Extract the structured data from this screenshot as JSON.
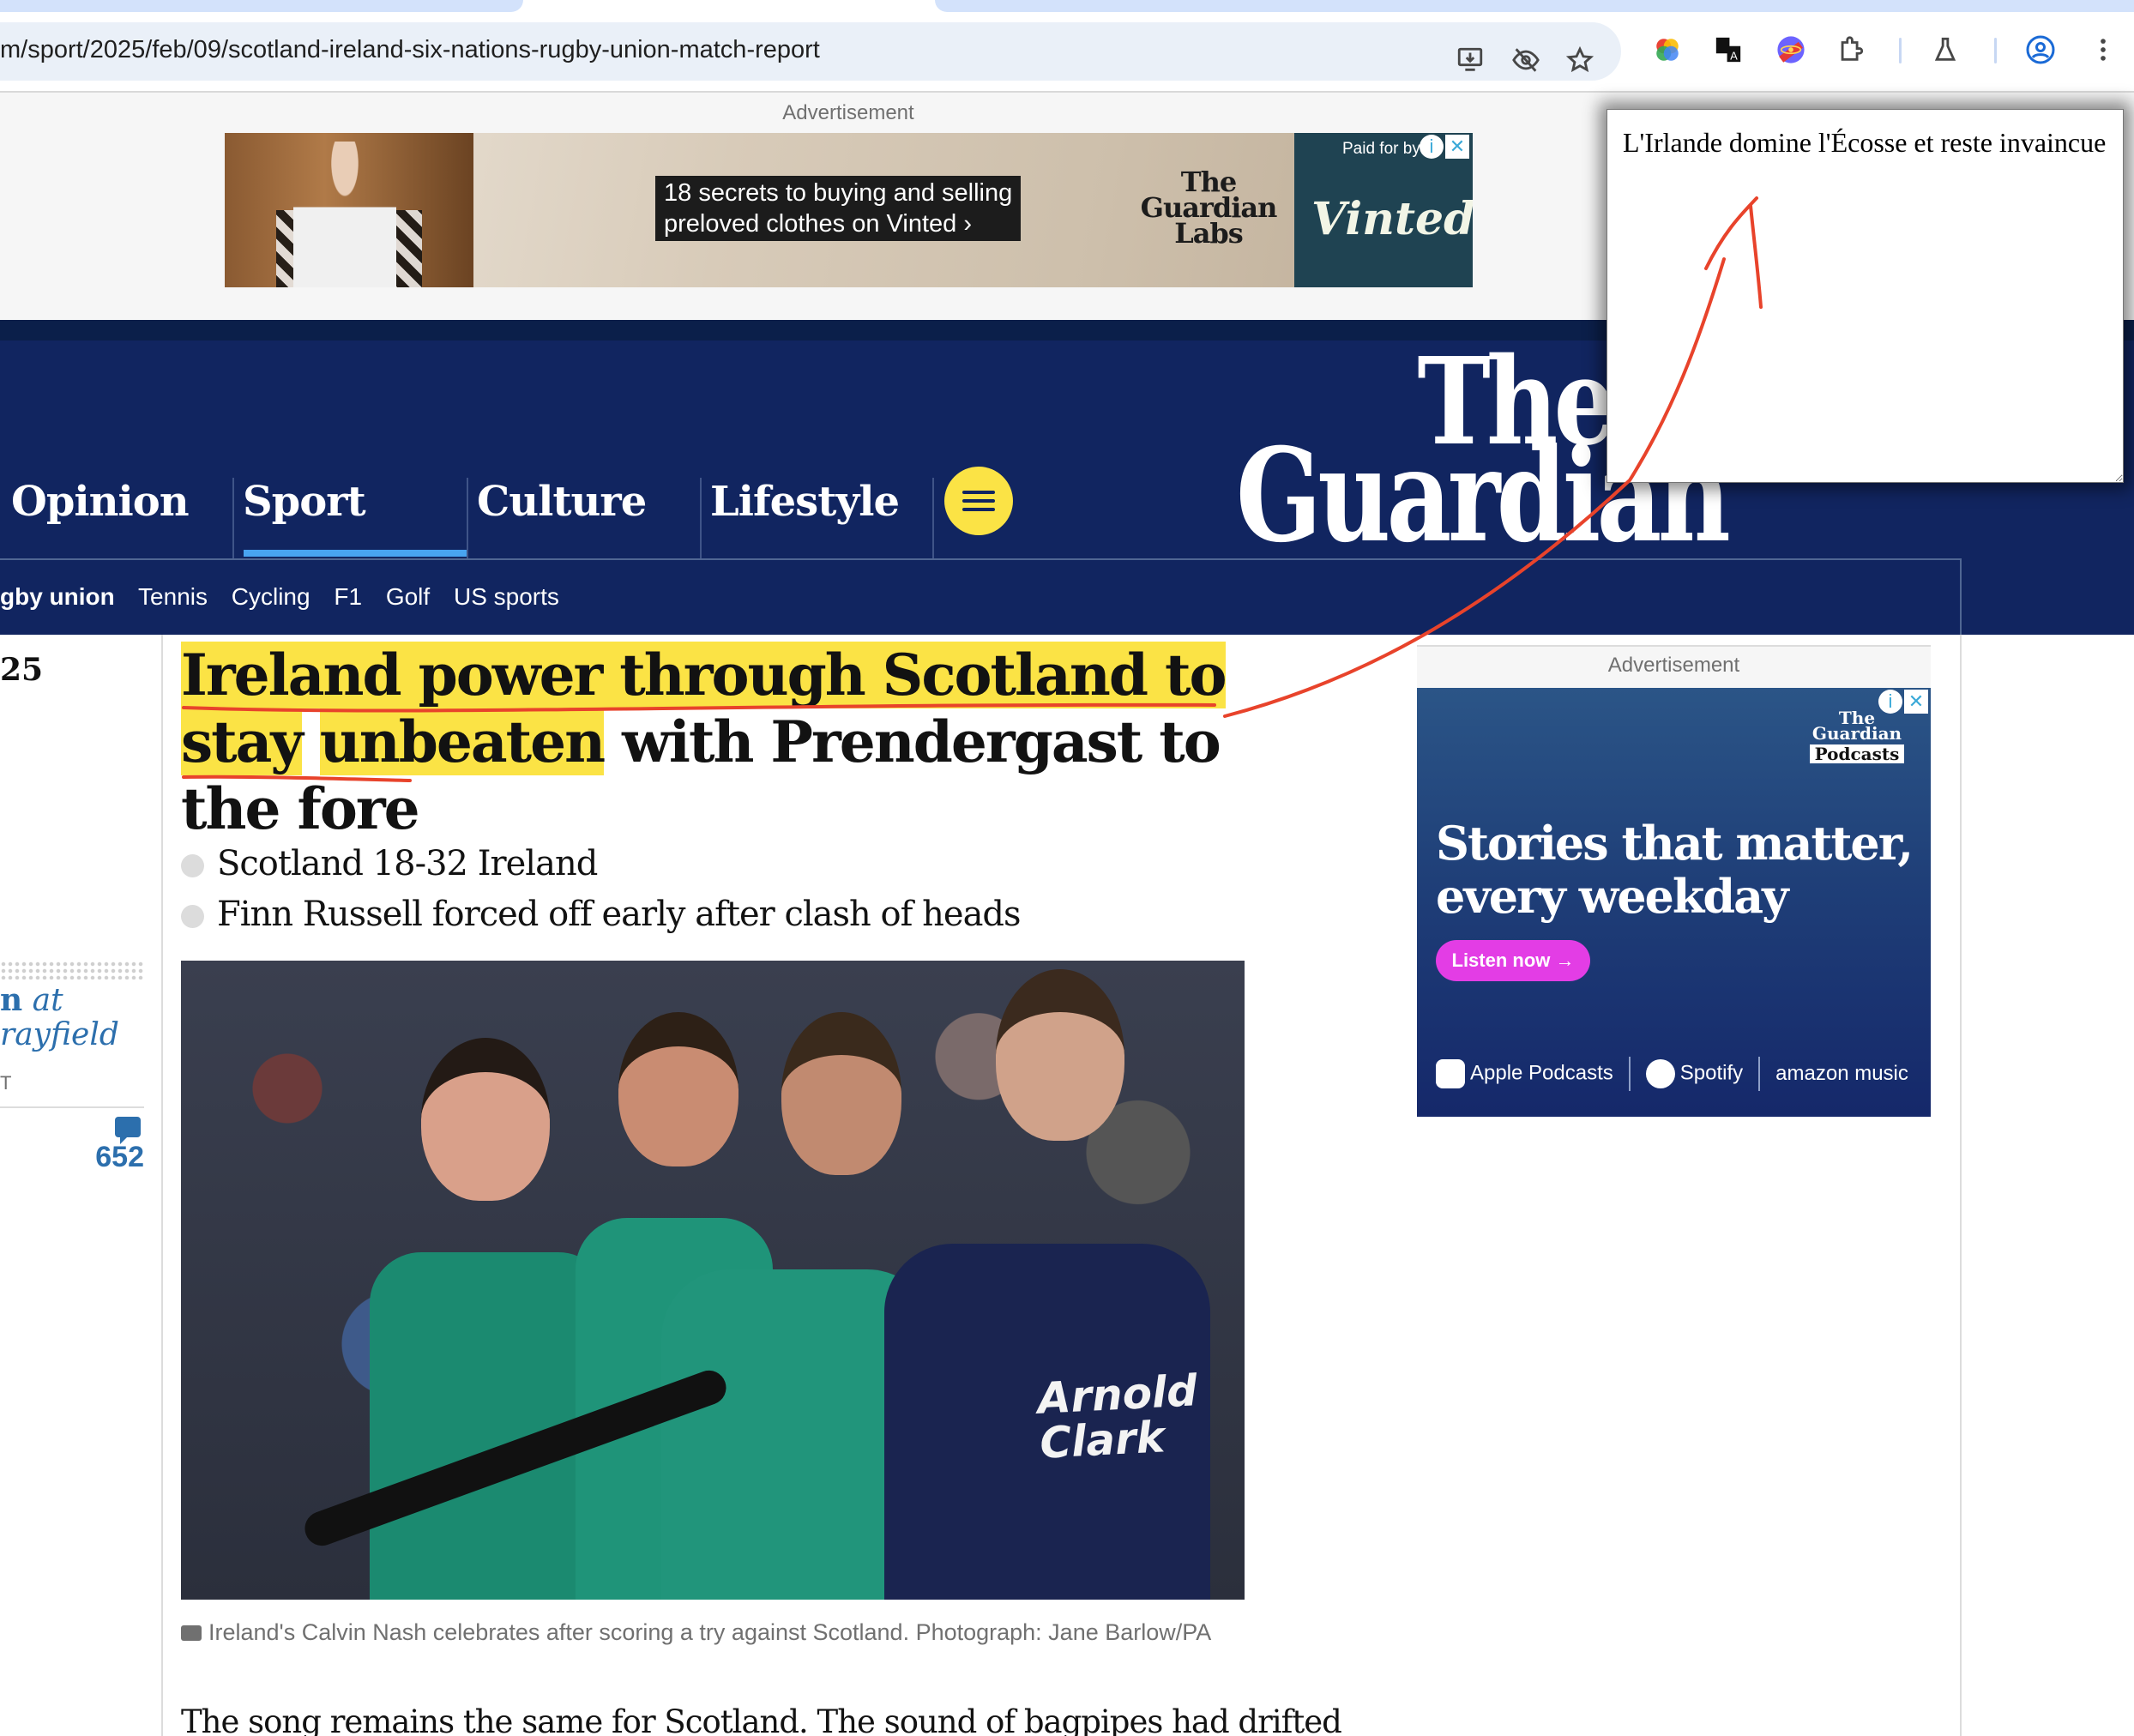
{
  "browser": {
    "url": "m/sport/2025/feb/09/scotland-ireland-six-nations-rugby-union-match-report",
    "toolbar_icons": [
      "install-app-icon",
      "tracking-protection-eye-icon",
      "bookmark-star-icon",
      "gemini-extension-icon",
      "translate-extension-icon",
      "react-devtools-extension-icon",
      "extensions-puzzle-icon",
      "labs-flask-icon",
      "profile-icon",
      "more-menu-icon"
    ]
  },
  "top_ad": {
    "label": "Advertisement",
    "headline_line1": "18 secrets to buying and selling",
    "headline_line2": "preloved clothes on Vinted ›",
    "labs_logo": [
      "The",
      "Guardian",
      "Labs"
    ],
    "paid_for": "Paid for by",
    "brand": "Vinted",
    "info_glyph": "i",
    "close_glyph": "✕"
  },
  "header": {
    "pillars": [
      {
        "label": "Opinion",
        "active": false
      },
      {
        "label": "Sport",
        "active": true
      },
      {
        "label": "Culture",
        "active": false
      },
      {
        "label": "Lifestyle",
        "active": false
      }
    ],
    "logo_line1": "The",
    "logo_line2": "Guardian",
    "subnav": [
      {
        "label": "gby union",
        "active": true
      },
      {
        "label": "Tennis",
        "active": false
      },
      {
        "label": "Cycling",
        "active": false
      },
      {
        "label": "F1",
        "active": false
      },
      {
        "label": "Golf",
        "active": false
      },
      {
        "label": "US sports",
        "active": false
      }
    ],
    "colors": {
      "navy": "#112560",
      "accent_blue": "#48a4f1",
      "menu_yellow": "#fbe345"
    }
  },
  "meta": {
    "date_fragment": "25",
    "byline_bold": "n",
    "byline_italic_1": "at",
    "byline_italic_2": "rayfield",
    "time_fragment": "T",
    "comment_count": "652"
  },
  "article": {
    "headline_highlighted_1": "Ireland power through Scotland to stay",
    "headline_highlighted_2": "unbeaten",
    "headline_rest": " with Prendergast to the fore",
    "standfirst": [
      "Scotland 18-32 Ireland",
      "Finn Russell forced off early after clash of heads"
    ],
    "photo_sponsor_line1": "Arnold",
    "photo_sponsor_line2": "Clark",
    "caption": "Ireland's Calvin Nash celebrates after scoring a try against Scotland. Photograph: Jane Barlow/PA",
    "body_first_line": "The song remains the same for Scotland. The sound of bagpipes had drifted",
    "highlight_color": "#fbe345"
  },
  "right_ad": {
    "label": "Advertisement",
    "logo_line1": "The",
    "logo_line2": "Guardian",
    "logo_line3": "Podcasts",
    "headline_line1": "Stories that matter,",
    "headline_line2": "every weekday",
    "cta": "Listen now →",
    "platforms": [
      "Apple Podcasts",
      "Spotify",
      "amazon music"
    ],
    "info_glyph": "i",
    "close_glyph": "✕"
  },
  "popup": {
    "text": "L'Irlande domine l'Écosse et reste invaincue"
  },
  "annotation": {
    "color": "#e8432b",
    "description": "hand-drawn red underline under highlighted headline with arrow pointing to the translation popup"
  }
}
